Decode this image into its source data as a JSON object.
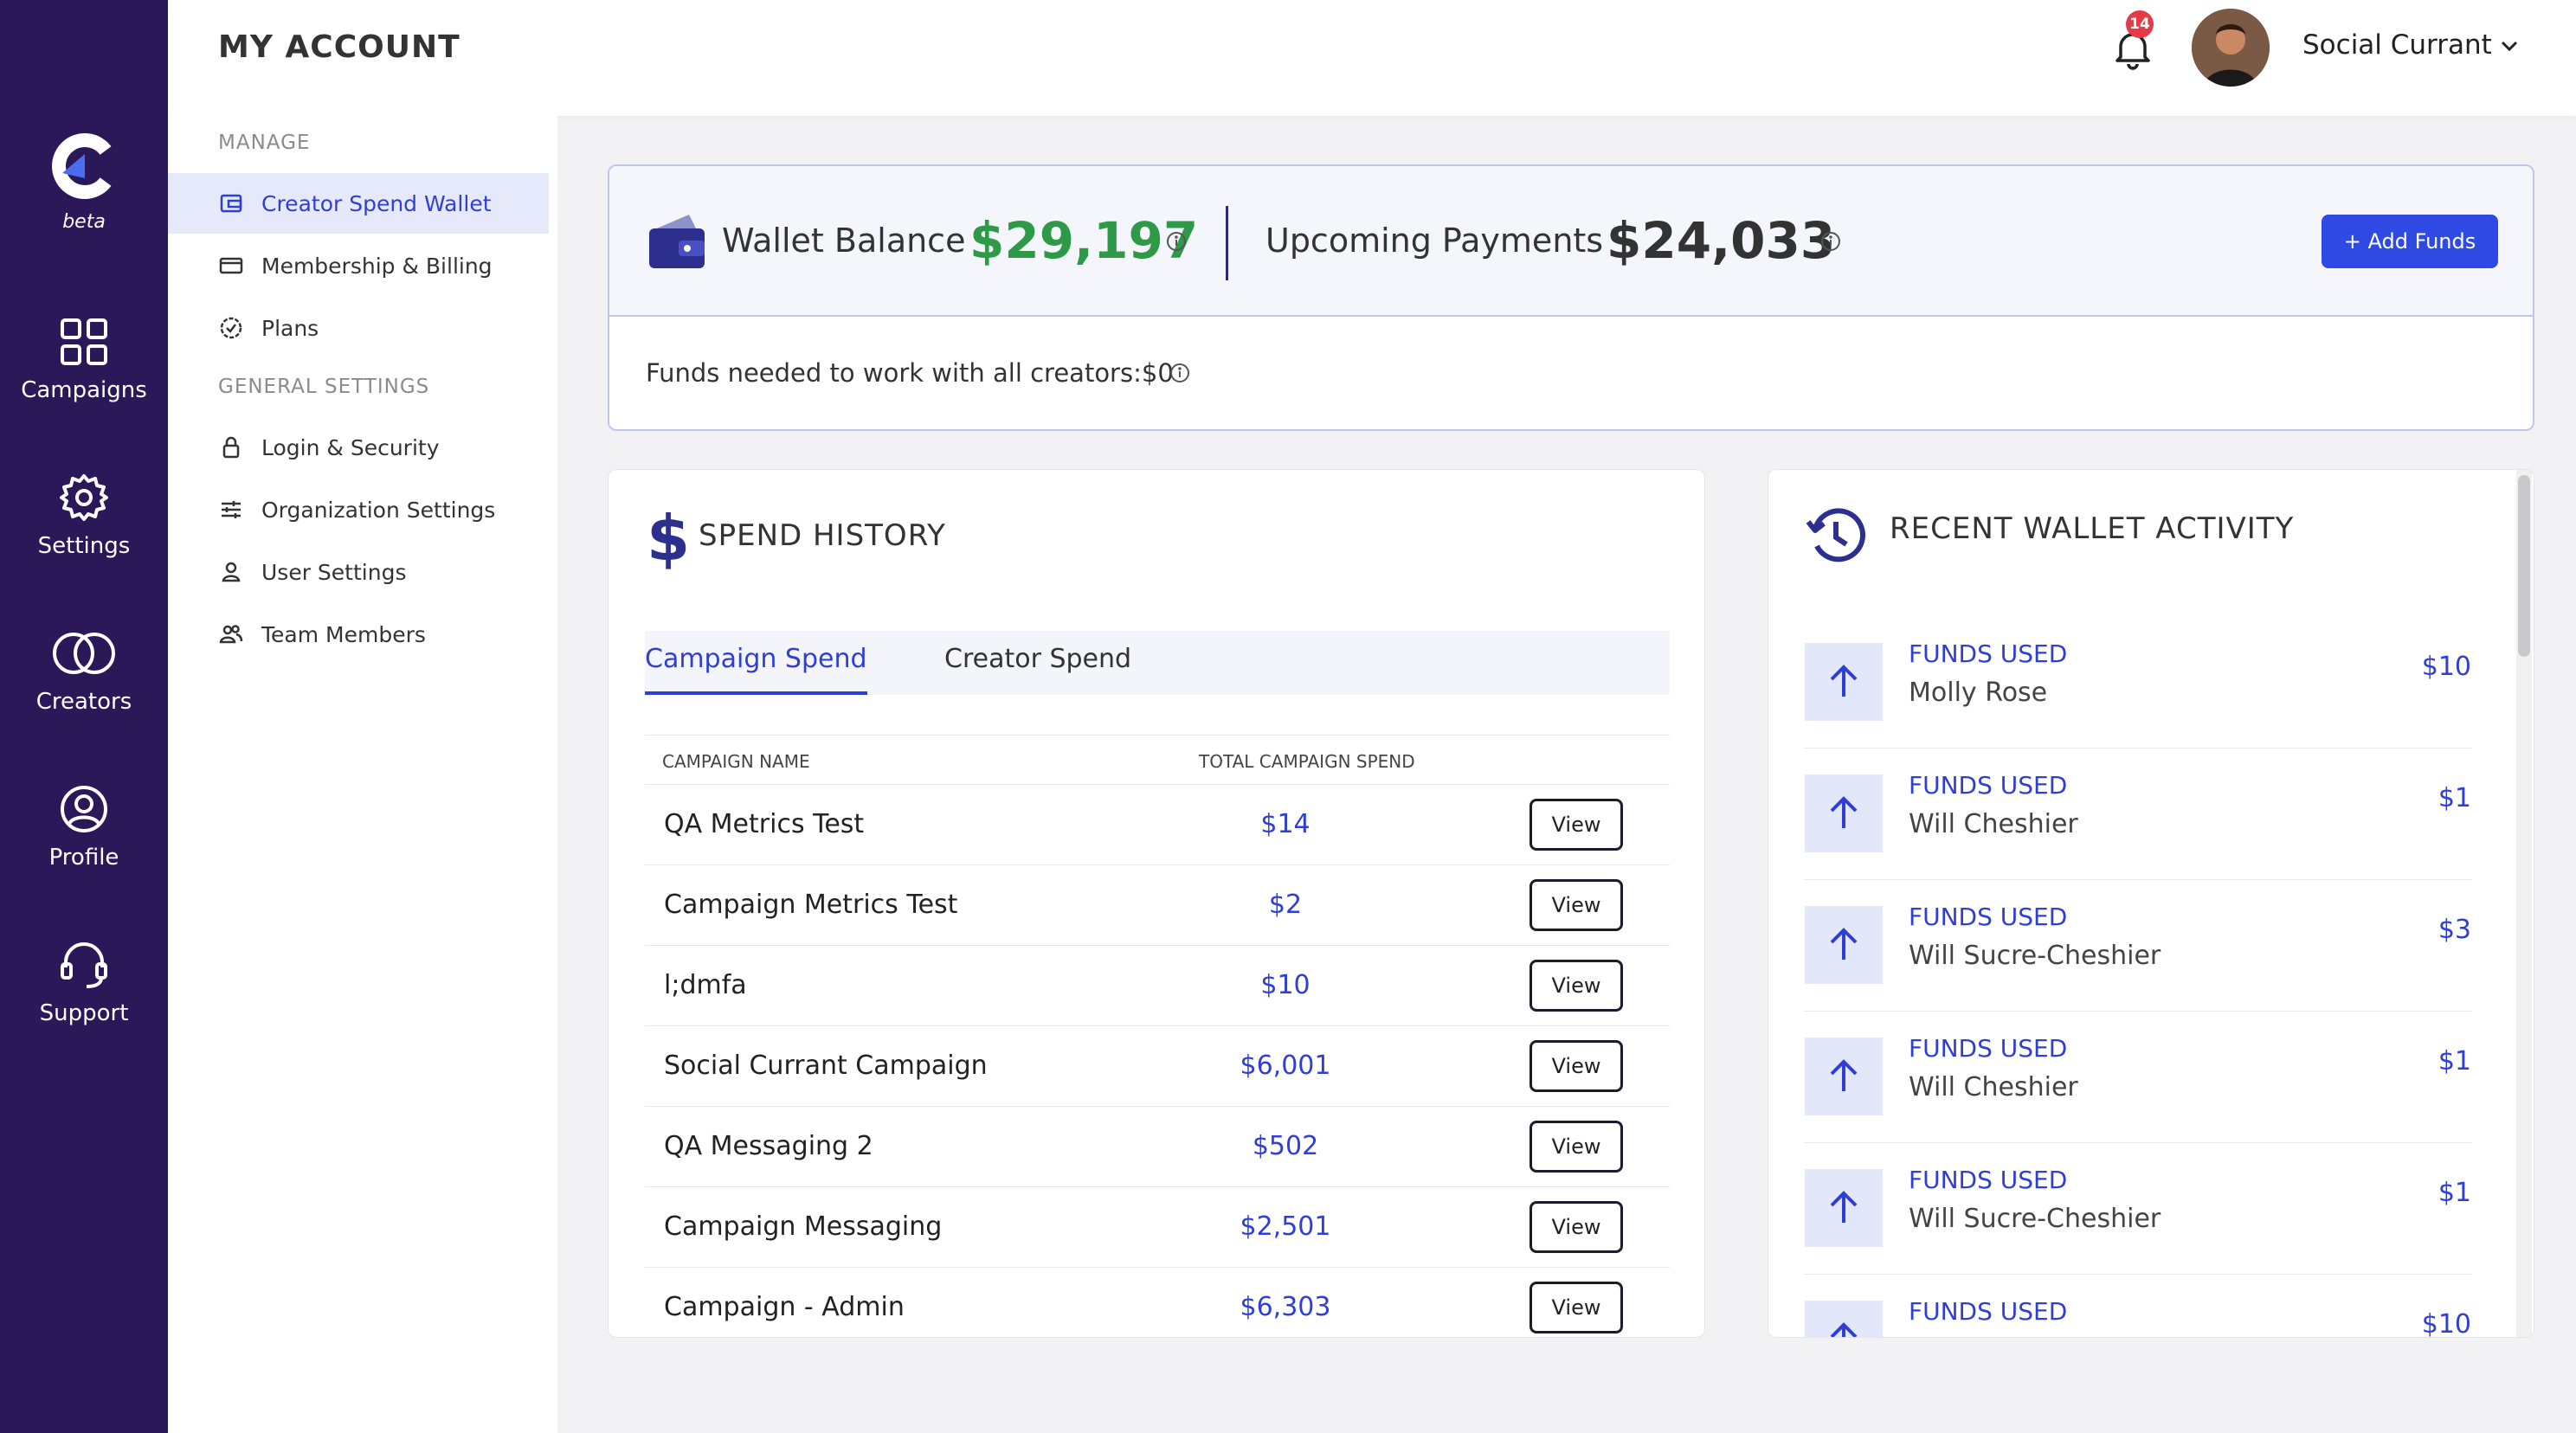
{
  "rail": {
    "beta": "beta",
    "items": [
      {
        "label": "Campaigns",
        "icon": "grid-icon"
      },
      {
        "label": "Settings",
        "icon": "gear-icon"
      },
      {
        "label": "Creators",
        "icon": "rings-icon"
      },
      {
        "label": "Profile",
        "icon": "user-circle-icon"
      },
      {
        "label": "Support",
        "icon": "headset-icon"
      }
    ]
  },
  "header": {
    "title": "MY ACCOUNT",
    "notification_count": "14",
    "user_name": "Social Currant"
  },
  "subnav": {
    "manage_heading": "MANAGE",
    "general_heading": "GENERAL SETTINGS",
    "manage_items": [
      {
        "label": "Creator Spend Wallet",
        "icon": "wallet-icon"
      },
      {
        "label": "Membership & Billing",
        "icon": "card-icon"
      },
      {
        "label": "Plans",
        "icon": "badge-check-icon"
      }
    ],
    "general_items": [
      {
        "label": "Login & Security",
        "icon": "lock-icon"
      },
      {
        "label": "Organization Settings",
        "icon": "sliders-icon"
      },
      {
        "label": "User Settings",
        "icon": "person-icon"
      },
      {
        "label": "Team Members",
        "icon": "people-icon"
      }
    ]
  },
  "wallet": {
    "balance_label": "Wallet Balance",
    "balance_value": "$29,197",
    "upcoming_label": "Upcoming Payments",
    "upcoming_value": "$24,033",
    "add_funds_label": "+ Add Funds",
    "funds_needed": "Funds needed to work with all creators:$0",
    "colors": {
      "balance": "#2e9a47",
      "accent": "#2f4ae3"
    }
  },
  "spend_history": {
    "title": "SPEND HISTORY",
    "tabs": [
      "Campaign Spend",
      "Creator Spend"
    ],
    "columns": [
      "CAMPAIGN NAME",
      "TOTAL CAMPAIGN SPEND"
    ],
    "view_label": "View",
    "rows": [
      {
        "name": "QA Metrics Test",
        "amount": "$14"
      },
      {
        "name": "Campaign Metrics Test",
        "amount": "$2"
      },
      {
        "name": "l;dmfa",
        "amount": "$10"
      },
      {
        "name": "Social Currant Campaign",
        "amount": "$6,001"
      },
      {
        "name": "QA Messaging 2",
        "amount": "$502"
      },
      {
        "name": "Campaign Messaging",
        "amount": "$2,501"
      },
      {
        "name": "Campaign - Admin",
        "amount": "$6,303"
      }
    ]
  },
  "activity": {
    "title": "RECENT WALLET ACTIVITY",
    "items": [
      {
        "type": "FUNDS USED",
        "who": "Molly Rose",
        "amount": "$10"
      },
      {
        "type": "FUNDS USED",
        "who": "Will Cheshier",
        "amount": "$1"
      },
      {
        "type": "FUNDS USED",
        "who": "Will Sucre-Cheshier",
        "amount": "$3"
      },
      {
        "type": "FUNDS USED",
        "who": "Will Cheshier",
        "amount": "$1"
      },
      {
        "type": "FUNDS USED",
        "who": "Will Sucre-Cheshier",
        "amount": "$1"
      },
      {
        "type": "FUNDS USED",
        "who": "",
        "amount": "$10"
      }
    ]
  }
}
